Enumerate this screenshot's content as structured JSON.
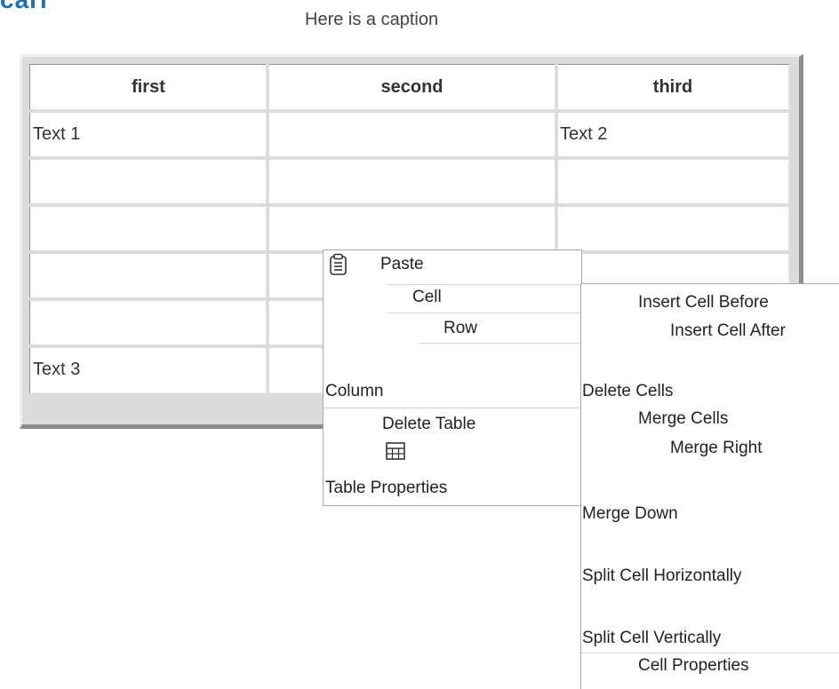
{
  "page": {
    "heading_fragment": "carr",
    "caption": "Here is a caption"
  },
  "table": {
    "headers": [
      "first",
      "second",
      "third"
    ],
    "rows": [
      [
        "Text 1",
        "",
        "Text 2"
      ],
      [
        "",
        "",
        ""
      ],
      [
        "",
        "",
        ""
      ],
      [
        "",
        "",
        ""
      ],
      [
        "",
        "",
        ""
      ],
      [
        "Text 3",
        "",
        ""
      ]
    ]
  },
  "context_menu": {
    "paste": "Paste",
    "cell": "Cell",
    "row": "Row",
    "column": "Column",
    "delete_table": "Delete Table",
    "table_properties": "Table Properties",
    "icons": [
      "clipboard-icon",
      "table-icon"
    ]
  },
  "cell_submenu": {
    "insert_before": "Insert Cell Before",
    "insert_after": "Insert Cell After",
    "delete_cells": "Delete Cells",
    "merge_cells": "Merge Cells",
    "merge_right": "Merge Right",
    "merge_down": "Merge Down",
    "split_horizontally": "Split Cell Horizontally",
    "split_vertically": "Split Cell Vertically",
    "cell_properties": "Cell Properties"
  },
  "colors": {
    "heading": "#1f6fa8",
    "menu_border": "#a9a9a9"
  }
}
